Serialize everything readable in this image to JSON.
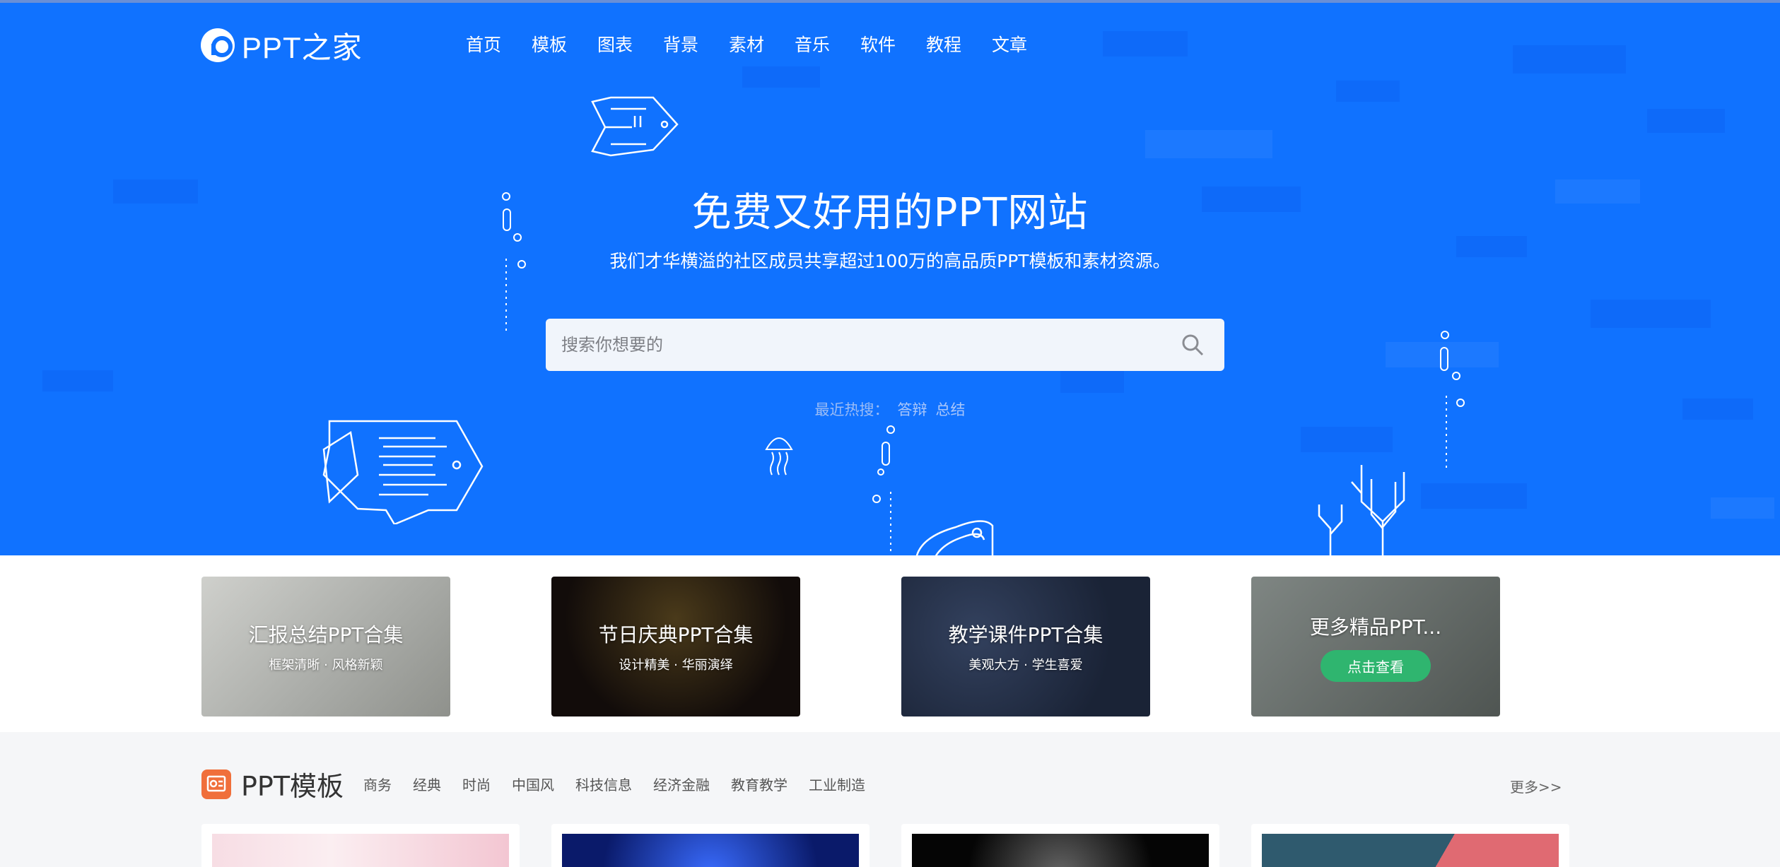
{
  "brand": {
    "name": "PPT之家"
  },
  "nav": [
    "首页",
    "模板",
    "图表",
    "背景",
    "素材",
    "音乐",
    "软件",
    "教程",
    "文章"
  ],
  "hero": {
    "title": "免费又好用的PPT网站",
    "subtitle": "我们才华横溢的社区成员共享超过100万的高品质PPT模板和素材资源。"
  },
  "search": {
    "placeholder": "搜索你想要的",
    "value": ""
  },
  "hot": {
    "label": "最近热搜：",
    "terms": [
      "答辩",
      "总结"
    ]
  },
  "banners": [
    {
      "title": "汇报总结PPT合集",
      "subtitle": "框架清晰 · 风格新颖"
    },
    {
      "title": "节日庆典PPT合集",
      "subtitle": "设计精美 · 华丽演绎"
    },
    {
      "title": "教学课件PPT合集",
      "subtitle": "美观大方 · 学生喜爱"
    },
    {
      "title": "更多精品PPT...",
      "button": "点击查看"
    }
  ],
  "section": {
    "title": "PPT模板",
    "categories": [
      "商务",
      "经典",
      "时尚",
      "中国风",
      "科技信息",
      "经济金融",
      "教育教学",
      "工业制造"
    ],
    "more": "更多>>"
  },
  "colors": {
    "hero_bg": "#1072ff",
    "accent_green": "#2fb56f",
    "section_icon": "#f06f3b"
  }
}
